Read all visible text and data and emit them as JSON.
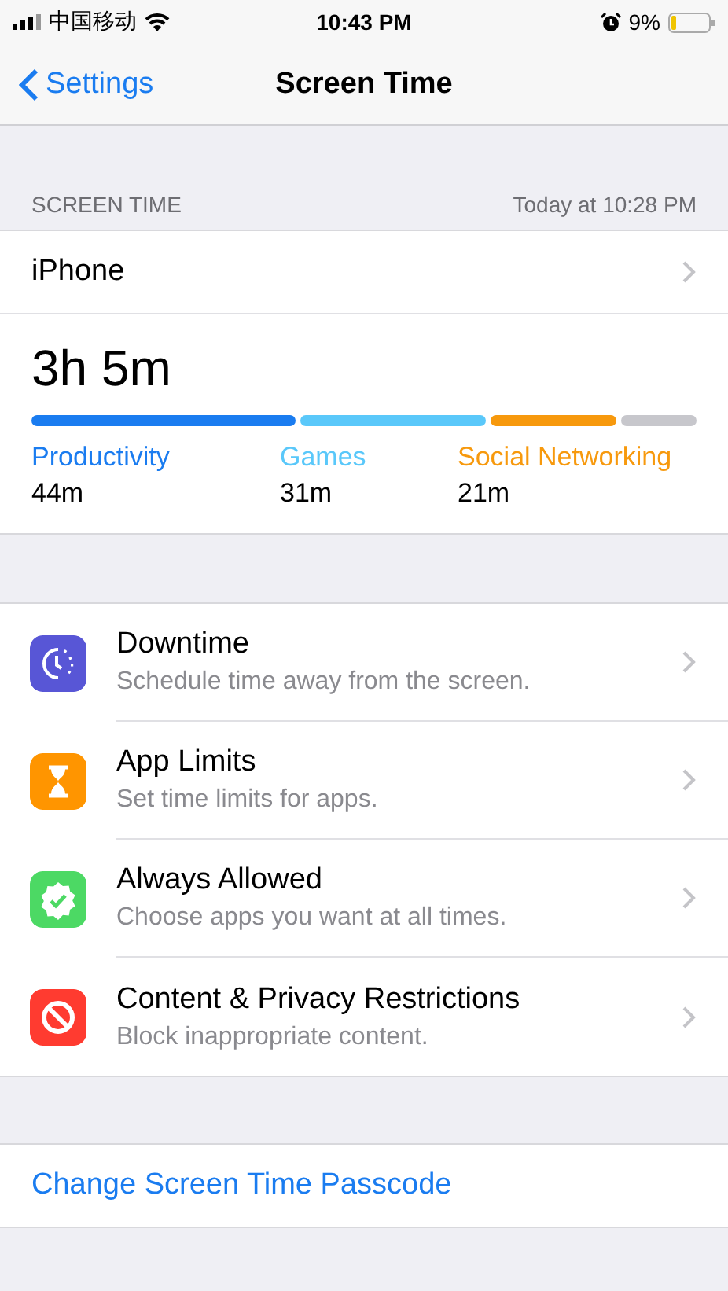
{
  "status_bar": {
    "carrier": "中国移动",
    "time": "10:43 PM",
    "battery": "9%"
  },
  "nav": {
    "back": "Settings",
    "title": "Screen Time"
  },
  "summary": {
    "header": "SCREEN TIME",
    "updated": "Today at 10:28 PM",
    "device": "iPhone",
    "total": "3h 5m",
    "categories": [
      {
        "label": "Productivity",
        "time": "44m",
        "color": "#1a7cf0"
      },
      {
        "label": "Games",
        "time": "31m",
        "color": "#5ac8fa"
      },
      {
        "label": "Social Networking",
        "time": "21m",
        "color": "#f7990d"
      }
    ]
  },
  "items": [
    {
      "kind": "downtime",
      "title": "Downtime",
      "subtitle": "Schedule time away from the screen."
    },
    {
      "kind": "limits",
      "title": "App Limits",
      "subtitle": "Set time limits for apps."
    },
    {
      "kind": "allowed",
      "title": "Always Allowed",
      "subtitle": "Choose apps you want at all times."
    },
    {
      "kind": "restrictions",
      "title": "Content & Privacy Restrictions",
      "subtitle": "Block inappropriate content."
    }
  ],
  "passcode_link": "Change Screen Time Passcode"
}
